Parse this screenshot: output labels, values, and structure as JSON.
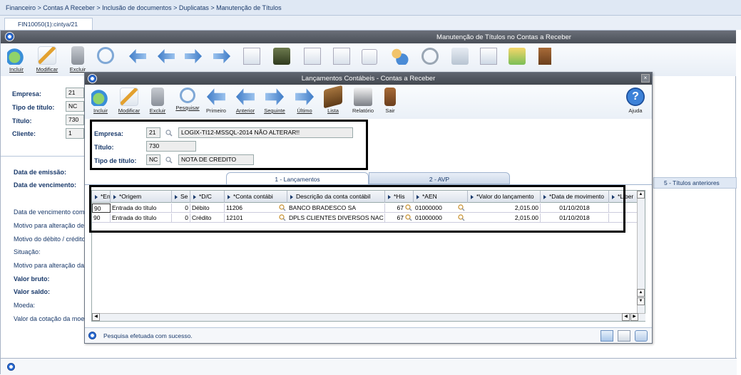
{
  "breadcrumb": "Financeiro > Contas A Receber > Inclusão de documentos > Duplicatas > Manutenção de Títulos",
  "outer_tab": "FIN10050(1):cintya/21",
  "outer_window_title": "Manutenção de Títulos no Contas a Receber",
  "outer_toolbar": [
    {
      "label": "Incluir",
      "icon": "add-icon"
    },
    {
      "label": "Modificar",
      "icon": "edit-icon"
    },
    {
      "label": "Excluir",
      "icon": "trash-icon"
    }
  ],
  "outer_form": {
    "empresa_label": "Empresa:",
    "empresa_value": "21",
    "tipo_label": "Tipo de título:",
    "tipo_value": "NC",
    "titulo_label": "Título:",
    "titulo_value": "730",
    "cliente_label": "Cliente:",
    "cliente_value": "1",
    "labels": [
      "Data de emissão:",
      "Data de vencimento:",
      "Data de vencimento com",
      "Motivo para alteração de",
      "Motivo do débito / crédito",
      "Situação:",
      "Motivo para alteração da",
      "Valor bruto:",
      "Valor saldo:",
      "Moeda:",
      "Valor da cotação da moe"
    ]
  },
  "right_panel_label": "5 - Títulos anteriores",
  "dialog": {
    "title": "Lançamentos Contábeis - Contas a Receber",
    "close": "×",
    "toolbar": [
      {
        "label": "Incluir",
        "icon": "add-icon"
      },
      {
        "label": "Modificar",
        "icon": "edit-icon"
      },
      {
        "label": "Excluir",
        "icon": "trash-icon"
      },
      {
        "label": "Pesquisar",
        "icon": "search-icon"
      },
      {
        "label": "Primeiro",
        "icon": "first-icon"
      },
      {
        "label": "Anterior",
        "icon": "previous-icon"
      },
      {
        "label": "Seguinte",
        "icon": "next-icon"
      },
      {
        "label": "Último",
        "icon": "last-icon"
      },
      {
        "label": "Lista",
        "icon": "list-icon"
      },
      {
        "label": "Relatório",
        "icon": "print-icon"
      },
      {
        "label": "Sair",
        "icon": "exit-icon"
      },
      {
        "label": "Ajuda",
        "icon": "help-icon"
      }
    ],
    "form": {
      "empresa_label": "Empresa:",
      "empresa_value": "21",
      "empresa_desc": "LOGIX-TI12-MSSQL-2014 NÃO ALTERAR!!",
      "titulo_label": "Título:",
      "titulo_value": "730",
      "tipo_label": "Tipo de título:",
      "tipo_value": "NC",
      "tipo_desc": "NOTA DE CREDITO"
    },
    "tabs": [
      "1 - Lançamentos",
      "2 - AVP"
    ],
    "grid": {
      "columns": [
        "*En",
        "*Origem",
        "Se",
        "*D/C",
        "*Conta contábi",
        "Descrição da conta contábil",
        "*His",
        "*AEN",
        "*Valor do lançamento",
        "*Data de movimento",
        "*Liber"
      ],
      "rows": [
        [
          "90",
          "Entrada do título",
          "0",
          "Débito",
          "11206",
          "BANCO BRADESCO SA",
          "67",
          "01000000",
          "2,015.00",
          "01/10/2018"
        ],
        [
          "90",
          "Entrada do título",
          "0",
          "Crédito",
          "12101",
          "DPLS CLIENTES DIVERSOS NAC",
          "67",
          "01000000",
          "2,015.00",
          "01/10/2018"
        ]
      ]
    },
    "status": "Pesquisa efetuada com sucesso."
  }
}
